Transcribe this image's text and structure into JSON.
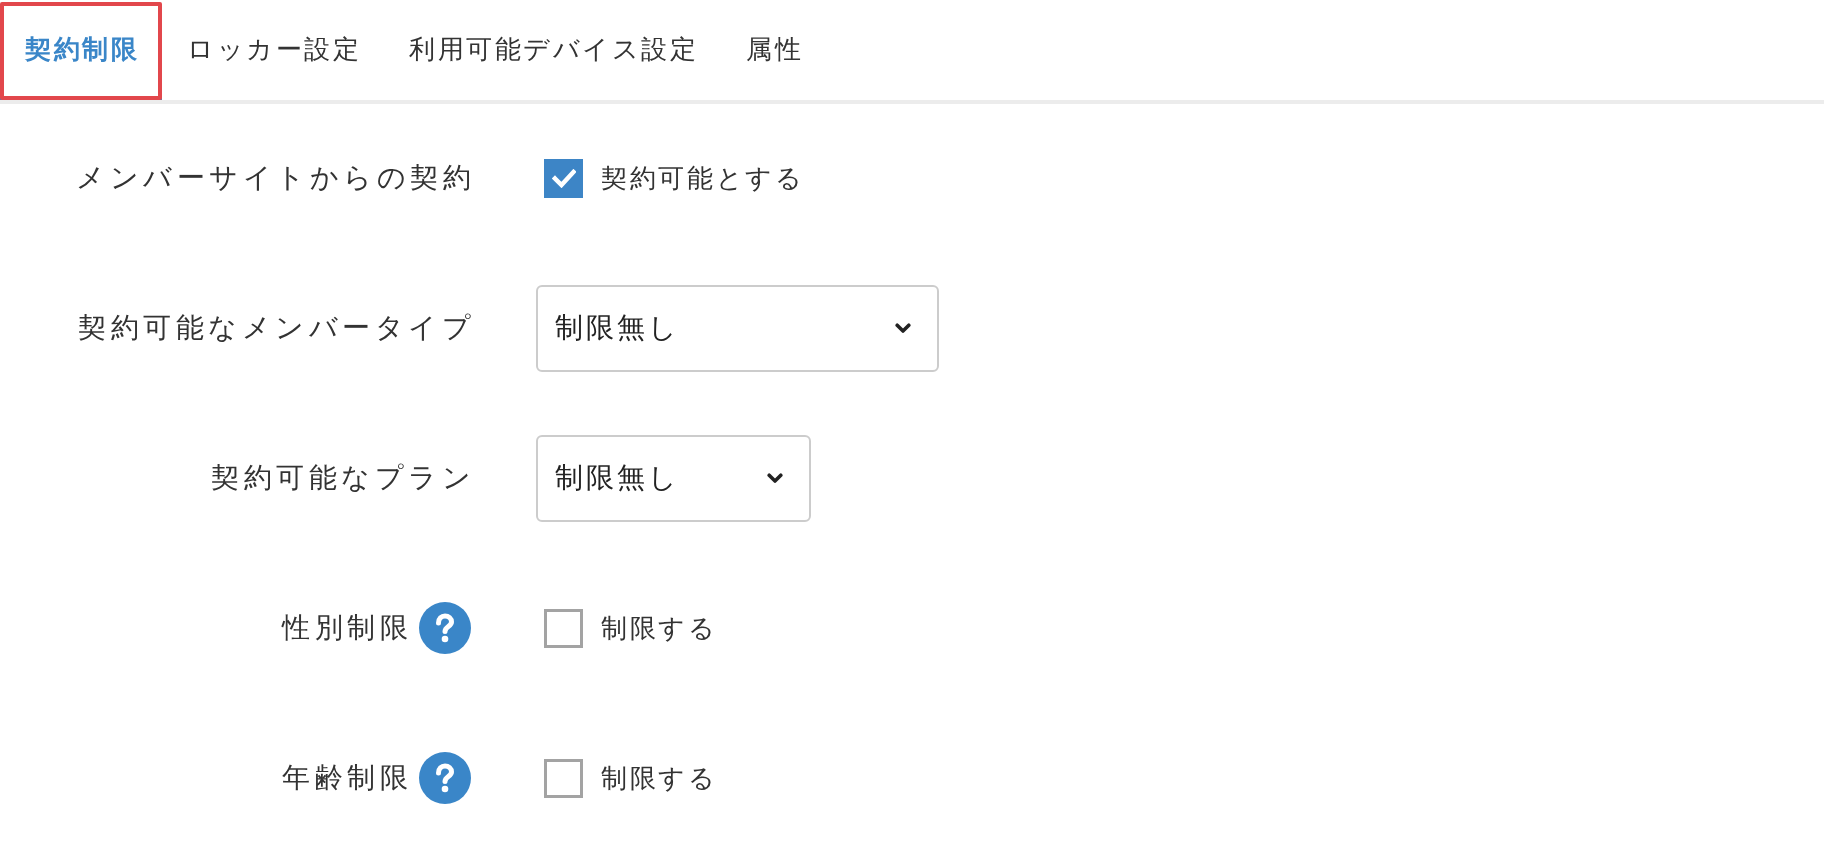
{
  "tabs": [
    {
      "label": "契約制限",
      "selected": true,
      "highlighted": true
    },
    {
      "label": "ロッカー設定",
      "selected": false,
      "highlighted": false
    },
    {
      "label": "利用可能デバイス設定",
      "selected": false,
      "highlighted": false
    },
    {
      "label": "属性",
      "selected": false,
      "highlighted": false
    }
  ],
  "form": {
    "rows": [
      {
        "kind": "checkbox",
        "label": "メンバーサイトからの契約",
        "help": false,
        "checked": true,
        "option": "契約可能とする"
      },
      {
        "kind": "select",
        "label": "契約可能なメンバータイプ",
        "help": false,
        "value": "制限無し"
      },
      {
        "kind": "select",
        "label": "契約可能なプラン",
        "help": false,
        "value": "制限無し"
      },
      {
        "kind": "checkbox",
        "label": "性別制限",
        "help": true,
        "checked": false,
        "option": "制限する"
      },
      {
        "kind": "checkbox",
        "label": "年齢制限",
        "help": true,
        "checked": false,
        "option": "制限する"
      }
    ]
  }
}
